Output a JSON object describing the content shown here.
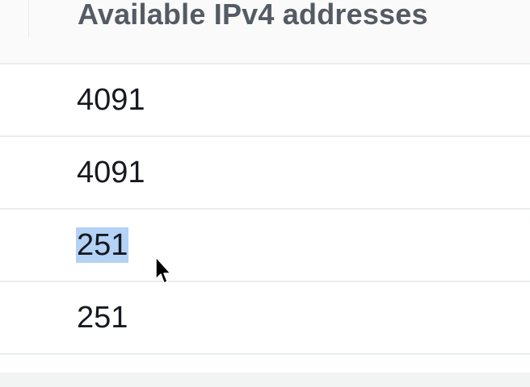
{
  "table": {
    "column_header": "Available IPv4 addresses",
    "rows": [
      {
        "available_ipv4": "4091"
      },
      {
        "available_ipv4": "4091"
      },
      {
        "available_ipv4": "251"
      },
      {
        "available_ipv4": "251"
      }
    ],
    "selected_row_index": 2
  },
  "colors": {
    "header_bg": "#fafafa",
    "header_text": "#545b64",
    "row_border": "#eaeded",
    "selection_highlight": "#b3d2f5"
  },
  "icons": {
    "cursor": "mouse-pointer-icon"
  }
}
